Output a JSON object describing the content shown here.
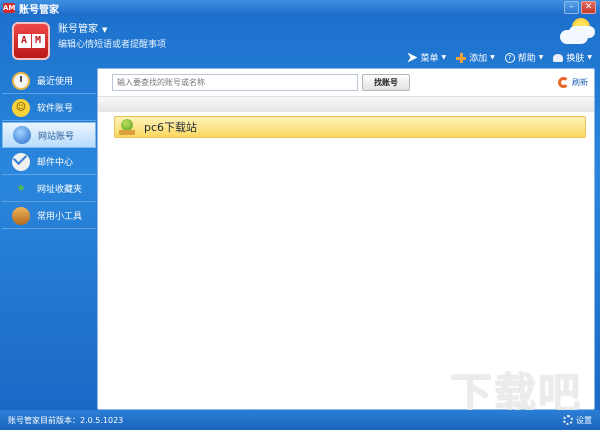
{
  "window": {
    "title": "账号管家",
    "app_icon_text": "AM"
  },
  "header": {
    "logo_letters": [
      "A",
      "M"
    ],
    "user_name": "账号管家",
    "signature": "编辑心情短语或者提醒事项"
  },
  "toolbar": {
    "menu_label": "菜单",
    "add_label": "添加",
    "help_label": "帮助",
    "skin_label": "换肤"
  },
  "sidebar": {
    "items": [
      {
        "label": "最近使用",
        "icon": "clock-icon"
      },
      {
        "label": "软件账号",
        "icon": "smiley-icon"
      },
      {
        "label": "网站账号",
        "icon": "globe-hand-icon",
        "active": true
      },
      {
        "label": "邮件中心",
        "icon": "mail-icon"
      },
      {
        "label": "网址收藏夹",
        "icon": "star-icon"
      },
      {
        "label": "常用小工具",
        "icon": "toolbox-icon"
      }
    ]
  },
  "search": {
    "placeholder": "输入要查找的账号或名称",
    "button_label": "找账号"
  },
  "refresh_label": "刷新",
  "accounts": [
    {
      "name": "pc6下载站"
    }
  ],
  "status": {
    "version_text": "账号管家目前版本：2.0.5.1023",
    "settings_label": "设置"
  },
  "watermark_text": "下载吧",
  "colors": {
    "accent": "#1e73c8",
    "selected_row": "#fde48a"
  }
}
